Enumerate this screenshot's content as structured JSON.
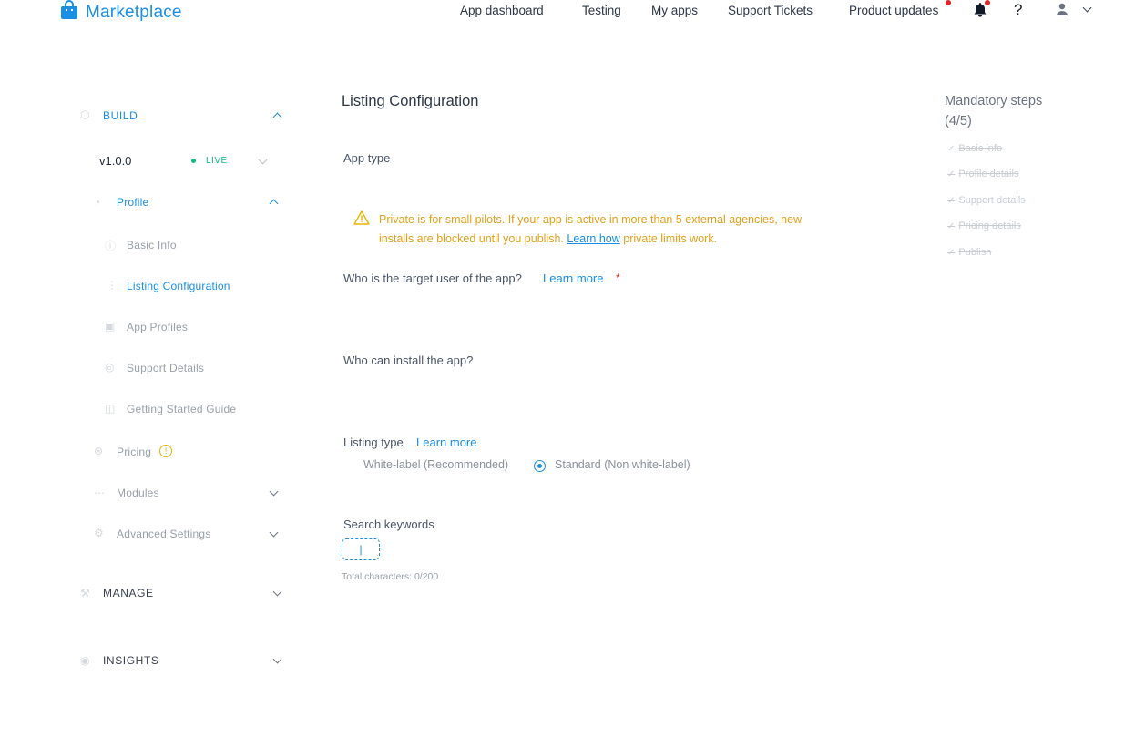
{
  "header": {
    "logo_text": "Marketplace",
    "nav": [
      "App dashboard",
      "Testing",
      "My apps",
      "Support Tickets",
      "Product updates"
    ],
    "help_glyph": "?",
    "accent": "#1a8fe3"
  },
  "sidebar": {
    "build_label": "BUILD",
    "version": "v1.0.0",
    "status": "LIVE",
    "status_color": "#10b981",
    "profile_label": "Profile",
    "profile_items": [
      "Basic Info",
      "Listing Configuration",
      "App Profiles",
      "Support Details",
      "Getting Started Guide"
    ],
    "pricing_label": "Pricing",
    "modules_label": "Modules",
    "advanced_label": "Advanced Settings",
    "manage_label": "MANAGE",
    "insights_label": "INSIGHTS"
  },
  "main": {
    "title": "Listing Configuration",
    "app_type_label": "App type",
    "warning_line1": "Private is for small pilots. If your app is active in more than 5 external agencies, new",
    "warning_line2_pre": "installs are blocked until you publish.",
    "warning_link": "Learn how",
    "warning_line2_post": "private limits work.",
    "target_user_label": "Who is the target user of the app?",
    "target_user_link": "Learn more",
    "required_mark": "*",
    "who_install_label": "Who can install the app?",
    "listing_type_label": "Listing type",
    "listing_type_link": "Learn more",
    "option_whitelabel": "White-label (Recommended)",
    "option_standard": "Standard (Non white-label)",
    "selected_option": "Standard (Non white-label)",
    "keywords_label": "Search keywords",
    "keywords_value": "",
    "char_count": "Total characters: 0/200"
  },
  "steps": {
    "title_line1": "Mandatory steps",
    "title_line2": "(4/5)",
    "items": [
      "Basic info",
      "Profile details",
      "Support details",
      "Pricing details",
      "Publish"
    ]
  }
}
